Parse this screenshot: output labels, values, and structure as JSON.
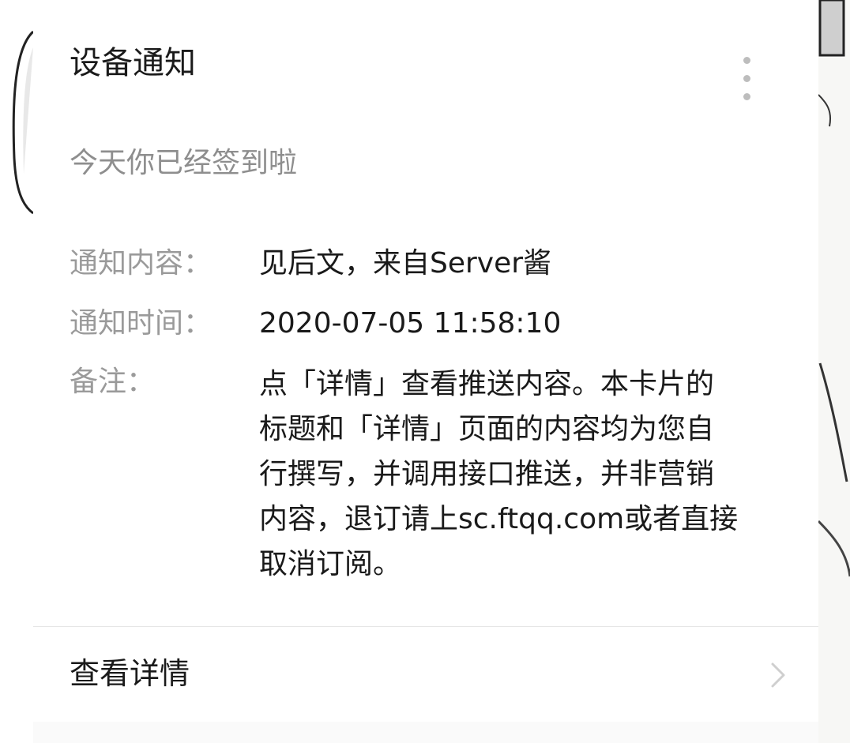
{
  "card": {
    "title": "设备通知",
    "subtitle": "今天你已经签到啦",
    "more_icon": "more-vertical-icon"
  },
  "info": {
    "content_label": "通知内容：",
    "content_value": "见后文，来自Server酱",
    "time_label": "通知时间：",
    "time_value": "2020-07-05 11:58:10",
    "note_label": "备注：",
    "note_value": "点「详情」查看推送内容。本卡片的\n标题和「详情」页面的内容均为您自\n行撰写，并调用接口推送，并非营销\n内容，退订请上sc.ftqq.com或者直接\n取消订阅。"
  },
  "footer": {
    "detail_label": "查看详情",
    "chevron_icon": "chevron-right-icon"
  },
  "colors": {
    "title": "#1a1a1a",
    "secondary_text": "#8e8e8e",
    "divider": "#e6e6e6",
    "icon_gray": "#bdbdbd"
  }
}
